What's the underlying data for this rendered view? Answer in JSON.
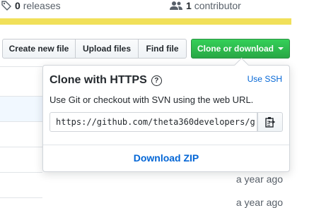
{
  "stats": {
    "releases_count": "0",
    "releases_label": "releases",
    "contributors_count": "1",
    "contributors_label": "contributor"
  },
  "toolbar": {
    "create_label": "Create new file",
    "upload_label": "Upload files",
    "find_label": "Find file",
    "clone_label": "Clone or download"
  },
  "clone_popup": {
    "title": "Clone with HTTPS",
    "help_symbol": "?",
    "use_ssh_label": "Use SSH",
    "description": "Use Git or checkout with SVN using the web URL.",
    "url": "https://github.com/theta360developers/g",
    "download_label": "Download ZIP"
  },
  "timestamps": [
    "a year ago",
    "a year ago"
  ],
  "colors": {
    "accent_green": "#28a745",
    "link_blue": "#0366d6",
    "language_bar": "#f1e05a"
  }
}
